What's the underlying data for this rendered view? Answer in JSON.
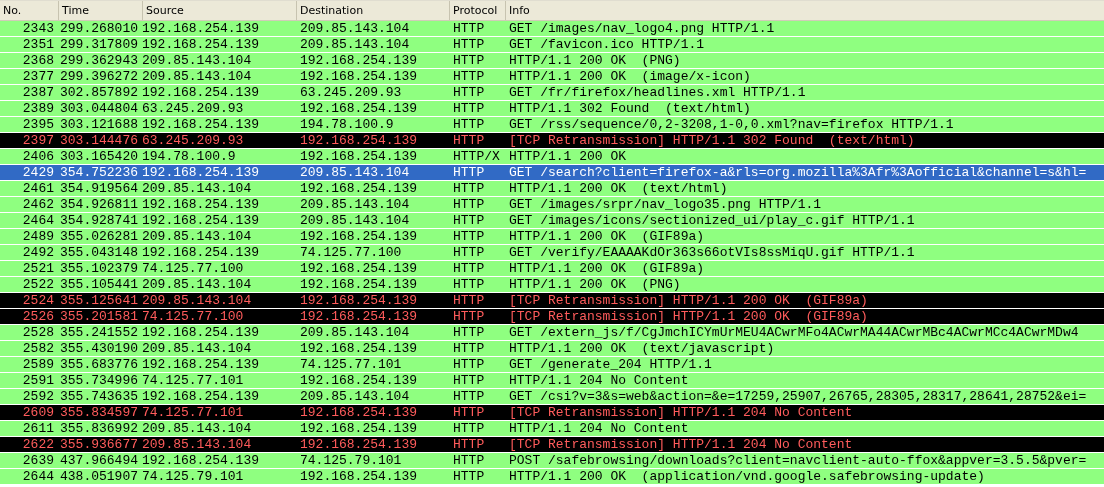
{
  "table": {
    "columns": [
      "No.",
      "Time",
      "Source",
      "Destination",
      "Protocol",
      "Info"
    ],
    "rows": [
      {
        "cells": [
          "2343",
          "299.268010",
          "192.168.254.139",
          "209.85.143.104",
          "HTTP",
          "GET /images/nav_logo4.png HTTP/1.1"
        ],
        "kind": "normal",
        "selected": false
      },
      {
        "cells": [
          "2351",
          "299.317809",
          "192.168.254.139",
          "209.85.143.104",
          "HTTP",
          "GET /favicon.ico HTTP/1.1"
        ],
        "kind": "normal",
        "selected": false
      },
      {
        "cells": [
          "2368",
          "299.362943",
          "209.85.143.104",
          "192.168.254.139",
          "HTTP",
          "HTTP/1.1 200 OK  (PNG)"
        ],
        "kind": "normal",
        "selected": false
      },
      {
        "cells": [
          "2377",
          "299.396272",
          "209.85.143.104",
          "192.168.254.139",
          "HTTP",
          "HTTP/1.1 200 OK  (image/x-icon)"
        ],
        "kind": "normal",
        "selected": false
      },
      {
        "cells": [
          "2387",
          "302.857892",
          "192.168.254.139",
          "63.245.209.93",
          "HTTP",
          "GET /fr/firefox/headlines.xml HTTP/1.1"
        ],
        "kind": "normal",
        "selected": false
      },
      {
        "cells": [
          "2389",
          "303.044804",
          "63.245.209.93",
          "192.168.254.139",
          "HTTP",
          "HTTP/1.1 302 Found  (text/html)"
        ],
        "kind": "normal",
        "selected": false
      },
      {
        "cells": [
          "2395",
          "303.121688",
          "192.168.254.139",
          "194.78.100.9",
          "HTTP",
          "GET /rss/sequence/0,2-3208,1-0,0.xml?nav=firefox HTTP/1.1"
        ],
        "kind": "normal",
        "selected": false
      },
      {
        "cells": [
          "2397",
          "303.144476",
          "63.245.209.93",
          "192.168.254.139",
          "HTTP",
          "[TCP Retransmission] HTTP/1.1 302 Found  (text/html)"
        ],
        "kind": "retransmission",
        "selected": false
      },
      {
        "cells": [
          "2406",
          "303.165420",
          "194.78.100.9",
          "192.168.254.139",
          "HTTP/X",
          "HTTP/1.1 200 OK"
        ],
        "kind": "normal",
        "selected": false
      },
      {
        "cells": [
          "2429",
          "354.752236",
          "192.168.254.139",
          "209.85.143.104",
          "HTTP",
          "GET /search?client=firefox-a&rls=org.mozilla%3Afr%3Aofficial&channel=s&hl="
        ],
        "kind": "normal",
        "selected": true
      },
      {
        "cells": [
          "2461",
          "354.919564",
          "209.85.143.104",
          "192.168.254.139",
          "HTTP",
          "HTTP/1.1 200 OK  (text/html)"
        ],
        "kind": "normal",
        "selected": false
      },
      {
        "cells": [
          "2462",
          "354.926811",
          "192.168.254.139",
          "209.85.143.104",
          "HTTP",
          "GET /images/srpr/nav_logo35.png HTTP/1.1"
        ],
        "kind": "normal",
        "selected": false
      },
      {
        "cells": [
          "2464",
          "354.928741",
          "192.168.254.139",
          "209.85.143.104",
          "HTTP",
          "GET /images/icons/sectionized_ui/play_c.gif HTTP/1.1"
        ],
        "kind": "normal",
        "selected": false
      },
      {
        "cells": [
          "2489",
          "355.026281",
          "209.85.143.104",
          "192.168.254.139",
          "HTTP",
          "HTTP/1.1 200 OK  (GIF89a)"
        ],
        "kind": "normal",
        "selected": false
      },
      {
        "cells": [
          "2492",
          "355.043148",
          "192.168.254.139",
          "74.125.77.100",
          "HTTP",
          "GET /verify/EAAAAKdOr363s66otVIs8ssMiqU.gif HTTP/1.1"
        ],
        "kind": "normal",
        "selected": false
      },
      {
        "cells": [
          "2521",
          "355.102379",
          "74.125.77.100",
          "192.168.254.139",
          "HTTP",
          "HTTP/1.1 200 OK  (GIF89a)"
        ],
        "kind": "normal",
        "selected": false
      },
      {
        "cells": [
          "2522",
          "355.105441",
          "209.85.143.104",
          "192.168.254.139",
          "HTTP",
          "HTTP/1.1 200 OK  (PNG)"
        ],
        "kind": "normal",
        "selected": false
      },
      {
        "cells": [
          "2524",
          "355.125641",
          "209.85.143.104",
          "192.168.254.139",
          "HTTP",
          "[TCP Retransmission] HTTP/1.1 200 OK  (GIF89a)"
        ],
        "kind": "retransmission",
        "selected": false
      },
      {
        "cells": [
          "2526",
          "355.201581",
          "74.125.77.100",
          "192.168.254.139",
          "HTTP",
          "[TCP Retransmission] HTTP/1.1 200 OK  (GIF89a)"
        ],
        "kind": "retransmission",
        "selected": false
      },
      {
        "cells": [
          "2528",
          "355.241552",
          "192.168.254.139",
          "209.85.143.104",
          "HTTP",
          "GET /extern_js/f/CgJmchICYmUrMEU4ACwrMFo4ACwrMA44ACwrMBc4ACwrMCc4ACwrMDw4"
        ],
        "kind": "normal",
        "selected": false
      },
      {
        "cells": [
          "2582",
          "355.430190",
          "209.85.143.104",
          "192.168.254.139",
          "HTTP",
          "HTTP/1.1 200 OK  (text/javascript)"
        ],
        "kind": "normal",
        "selected": false
      },
      {
        "cells": [
          "2589",
          "355.683776",
          "192.168.254.139",
          "74.125.77.101",
          "HTTP",
          "GET /generate_204 HTTP/1.1"
        ],
        "kind": "normal",
        "selected": false
      },
      {
        "cells": [
          "2591",
          "355.734996",
          "74.125.77.101",
          "192.168.254.139",
          "HTTP",
          "HTTP/1.1 204 No Content"
        ],
        "kind": "normal",
        "selected": false
      },
      {
        "cells": [
          "2592",
          "355.743635",
          "192.168.254.139",
          "209.85.143.104",
          "HTTP",
          "GET /csi?v=3&s=web&action=&e=17259,25907,26765,28305,28317,28641,28752&ei="
        ],
        "kind": "normal",
        "selected": false
      },
      {
        "cells": [
          "2609",
          "355.834597",
          "74.125.77.101",
          "192.168.254.139",
          "HTTP",
          "[TCP Retransmission] HTTP/1.1 204 No Content"
        ],
        "kind": "retransmission",
        "selected": false
      },
      {
        "cells": [
          "2611",
          "355.836992",
          "209.85.143.104",
          "192.168.254.139",
          "HTTP",
          "HTTP/1.1 204 No Content"
        ],
        "kind": "normal",
        "selected": false
      },
      {
        "cells": [
          "2622",
          "355.936677",
          "209.85.143.104",
          "192.168.254.139",
          "HTTP",
          "[TCP Retransmission] HTTP/1.1 204 No Content"
        ],
        "kind": "retransmission",
        "selected": false
      },
      {
        "cells": [
          "2639",
          "437.966494",
          "192.168.254.139",
          "74.125.79.101",
          "HTTP",
          "POST /safebrowsing/downloads?client=navclient-auto-ffox&appver=3.5.5&pver="
        ],
        "kind": "normal",
        "selected": false
      },
      {
        "cells": [
          "2644",
          "438.051907",
          "74.125.79.101",
          "192.168.254.139",
          "HTTP",
          "HTTP/1.1 200 OK  (application/vnd.google.safebrowsing-update)"
        ],
        "kind": "normal",
        "selected": false
      }
    ]
  }
}
